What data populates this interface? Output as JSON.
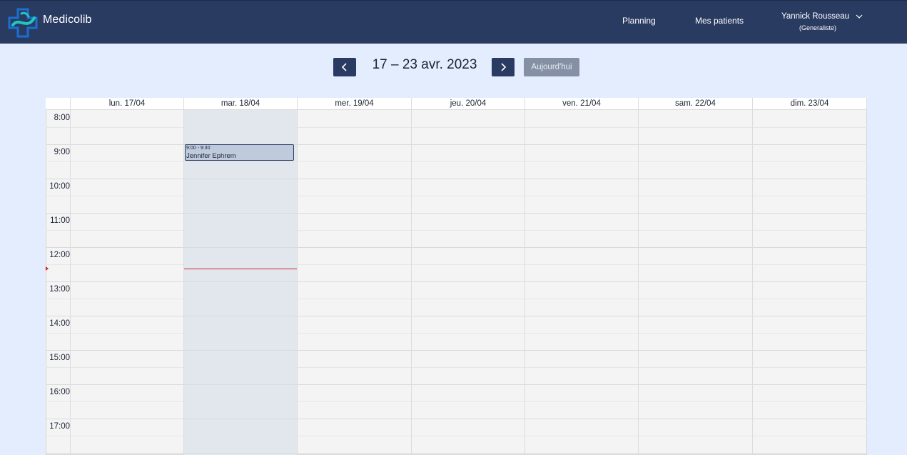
{
  "header": {
    "brand": "Medicolib",
    "nav": [
      "Planning",
      "Mes patients"
    ],
    "user": {
      "name": "Yannick Rousseau",
      "role": "(Generaliste)"
    },
    "colors": {
      "bar": "#2a3b62",
      "logo_blue": "#1a6fd1",
      "logo_teal": "#1ec8c0"
    }
  },
  "toolbar": {
    "week_title": "17 – 23 avr. 2023",
    "prev_icon": "chevron-left-icon",
    "next_icon": "chevron-right-icon",
    "today_label": "Aujourd'hui"
  },
  "calendar": {
    "days": [
      "lun. 17/04",
      "mar. 18/04",
      "mer. 19/04",
      "jeu. 20/04",
      "ven. 21/04",
      "sam. 22/04",
      "dim. 23/04"
    ],
    "hours": [
      "8:00",
      "9:00",
      "10:00",
      "11:00",
      "12:00",
      "13:00",
      "14:00",
      "15:00",
      "16:00",
      "17:00"
    ],
    "today_index": 1,
    "now_line_color": "#d0202a",
    "events": [
      {
        "day_index": 1,
        "time": "9:00 - 9:30",
        "title": "Jennifer Ephrem"
      }
    ]
  }
}
